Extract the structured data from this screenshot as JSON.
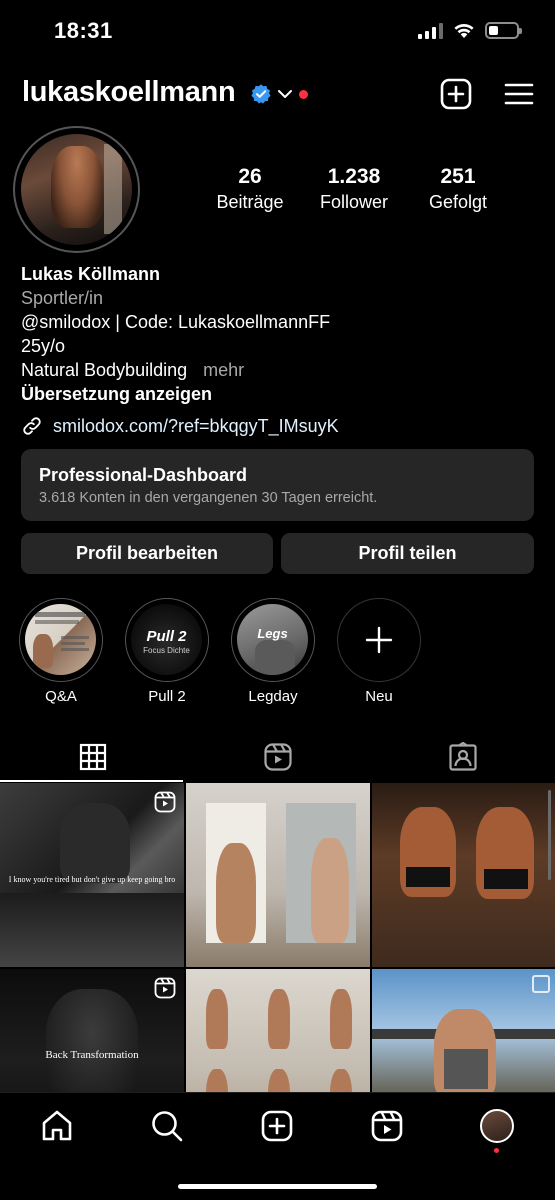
{
  "status_bar": {
    "time": "18:31",
    "battery_level": 0.35
  },
  "header": {
    "username": "lukaskoellmann",
    "verified": true,
    "notification_dot": true
  },
  "profile": {
    "stats": [
      {
        "value": "26",
        "label": "Beiträge"
      },
      {
        "value": "1.238",
        "label": "Follower"
      },
      {
        "value": "251",
        "label": "Gefolgt"
      }
    ],
    "name": "Lukas Köllmann",
    "category": "Sportler/in",
    "bio_lines": [
      "@smilodox | Code: LukaskoellmannFF",
      "25y/o",
      "Natural Bodybuilding"
    ],
    "more_label": "mehr",
    "translate_label": "Übersetzung anzeigen",
    "link": "smilodox.com/?ref=bkqgyT_IMsuyK"
  },
  "dashboard": {
    "title": "Professional-Dashboard",
    "subtitle": "3.618 Konten in den vergangenen 30 Tagen erreicht."
  },
  "buttons": {
    "edit": "Profil bearbeiten",
    "share": "Profil teilen"
  },
  "highlights": [
    {
      "label": "Q&A",
      "cover_text": ""
    },
    {
      "label": "Pull 2",
      "cover_text": "Pull 2",
      "cover_subtext": "Focus Dichte"
    },
    {
      "label": "Legday",
      "cover_text": "Legs"
    },
    {
      "label": "Neu",
      "cover_text": ""
    }
  ],
  "tabs": [
    {
      "name": "grid",
      "icon": "grid-icon",
      "active": true
    },
    {
      "name": "reels",
      "icon": "reels-icon",
      "active": false
    },
    {
      "name": "tagged",
      "icon": "tagged-icon",
      "active": false
    }
  ],
  "posts": [
    {
      "caption": "I know you're tired but don't give up keep going bro",
      "reel": true
    },
    {
      "caption": "",
      "reel": false
    },
    {
      "caption": "",
      "reel": false
    },
    {
      "caption": "Back Transformation",
      "reel": true
    },
    {
      "caption": "",
      "reel": false
    },
    {
      "caption": "",
      "reel": false
    }
  ],
  "bottom_nav": [
    "home-icon",
    "search-icon",
    "create-icon",
    "reels-icon",
    "profile-avatar"
  ]
}
